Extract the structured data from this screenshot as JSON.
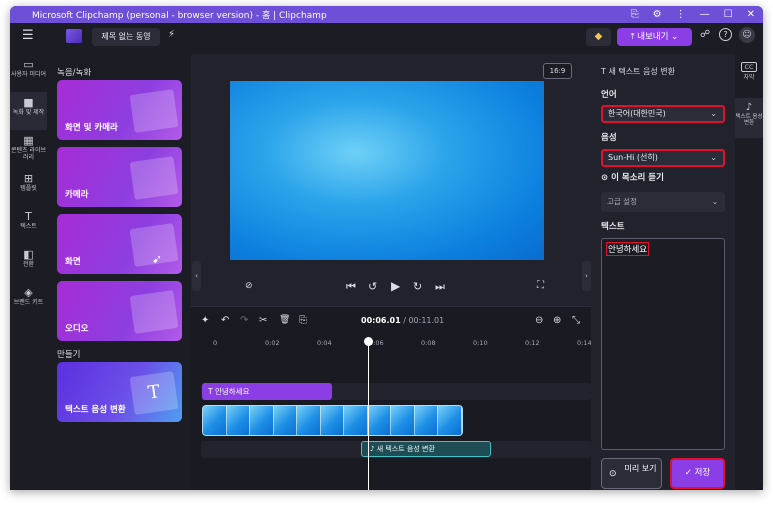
{
  "window": {
    "title": "Microsoft Clipchamp (personal - browser version) - 홈 | Clipchamp",
    "controls": [
      "⎘",
      "⚙",
      "⋮",
      "—",
      "☐",
      "✕"
    ]
  },
  "topbar": {
    "menu_icon": "☰",
    "project_title": "제목 없는 동영",
    "export_label": "내보내기",
    "export_icon": "⤒",
    "premium_icon": "◆",
    "share_icon": "☍",
    "help_icon": "?",
    "avatar_icon": "☺"
  },
  "leftnav": {
    "items": [
      {
        "icon": "▭",
        "label": "사용자 미디어"
      },
      {
        "icon": "■",
        "label": "녹화 및 제작"
      },
      {
        "icon": "▦",
        "label": "콘텐츠 라이브러리"
      },
      {
        "icon": "⊞",
        "label": "템플릿"
      },
      {
        "icon": "T",
        "label": "텍스트"
      },
      {
        "icon": "◧",
        "label": "전환"
      },
      {
        "icon": "◈",
        "label": "브랜드 키트"
      }
    ]
  },
  "library": {
    "section_record": "녹음/녹화",
    "cards": [
      {
        "label": "화면 및 카메라"
      },
      {
        "label": "카메라"
      },
      {
        "label": "화면"
      },
      {
        "label": "오디오"
      }
    ],
    "section_create": "만들기",
    "create_card": {
      "label": "텍스트 음성 변환",
      "icon": "T"
    }
  },
  "preview": {
    "aspect_ratio": "16:9",
    "controls": {
      "captions_off": "⊘",
      "skip_back": "⏮",
      "rewind": "↺",
      "play": "▶",
      "forward": "↻",
      "skip_forward": "⏭",
      "fullscreen": "⛶"
    }
  },
  "timeline": {
    "current_time": "00:06.01",
    "total_time": "00:11.01",
    "tools": [
      "✦",
      "↶",
      "↷",
      "✂",
      "🗑",
      "⎘"
    ],
    "zoom_out": "⊖",
    "zoom_in": "⊕",
    "fit": "⤡",
    "ruler": [
      "0",
      "0:02",
      "0:04",
      "0:06",
      "0:08",
      "0:10",
      "0:12",
      "0:14"
    ],
    "text_clip": "안녕하세요",
    "audio_clip": "새 텍스트 음성 변환"
  },
  "panel": {
    "header": "새 텍스트 음성 변환",
    "language_label": "언어",
    "language_value": "한국어(대한민국)",
    "voice_label": "음성",
    "voice_value": "Sun-Hi (선히)",
    "listen_label": "이 목소리 듣기",
    "advanced_label": "고급 설정",
    "text_label": "텍스트",
    "text_value": "안녕하세요",
    "preview_button": "미리 보기",
    "save_button": "저장"
  },
  "rightrail": {
    "items": [
      {
        "icon": "CC",
        "label": "자막"
      },
      {
        "icon": "♪",
        "label": "텍스트 음성 변환"
      }
    ]
  },
  "colors": {
    "accent": "#8b3ee6",
    "highlight_border": "#e0112f",
    "titlebar": "#6e4fd8",
    "background": "#1c1c25"
  }
}
